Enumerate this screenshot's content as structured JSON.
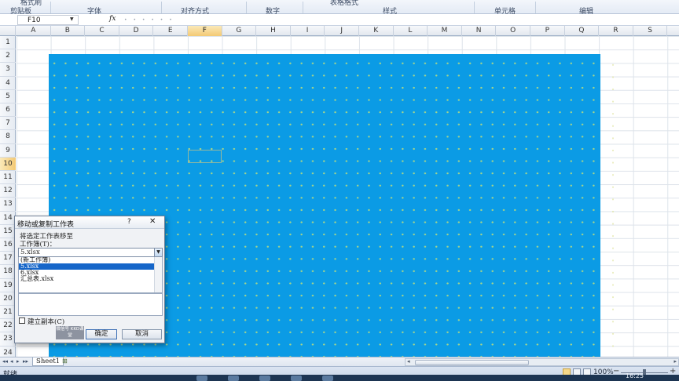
{
  "ribbon": {
    "cut_label": "格式刷",
    "groups": [
      "剪贴板",
      "字体",
      "对齐方式",
      "数字",
      "样式",
      "单元格",
      "编辑"
    ],
    "cut_top_label": "表格格式"
  },
  "formula_bar": {
    "name_box": "F10",
    "fx_label": "fx",
    "formula": ""
  },
  "columns": [
    "A",
    "B",
    "C",
    "D",
    "E",
    "F",
    "G",
    "H",
    "I",
    "J",
    "K",
    "L",
    "M",
    "N",
    "O",
    "P",
    "Q",
    "R",
    "S"
  ],
  "active_column": "F",
  "rows": [
    "1",
    "2",
    "3",
    "4",
    "5",
    "6",
    "7",
    "8",
    "9",
    "10",
    "11",
    "12",
    "13",
    "14",
    "15",
    "16",
    "17",
    "18",
    "19",
    "20",
    "21",
    "22",
    "23",
    "24"
  ],
  "active_row": "10",
  "shape": {
    "fill_color": "#0b9be5",
    "dot_color": "#d6e86e"
  },
  "dialog": {
    "title": "移动或复制工作表",
    "help": "?",
    "close": "✕",
    "move_to_label": "将选定工作表移至",
    "workbook_label": "工作簿(T)：",
    "workbook_value": "5.xlsx",
    "workbook_options": [
      "(新工作簿)",
      "5.xlsx",
      "6.xlsx",
      "汇总表.xlsx"
    ],
    "selected_option": "5.xlsx",
    "copy_label": "建立副本(C)",
    "copy_checked": false,
    "ok_label": "确定",
    "cancel_label": "取消",
    "watermark": "微信号 KKO课堂"
  },
  "sheet_tabs": {
    "nav": [
      "◂◂",
      "◂",
      "▸",
      "▸▸"
    ],
    "active_sheet": "Sheet1"
  },
  "status": {
    "text": "就绪",
    "zoom": "100%",
    "zoom_minus": "−",
    "zoom_plus": "+",
    "clock": "16:25"
  }
}
